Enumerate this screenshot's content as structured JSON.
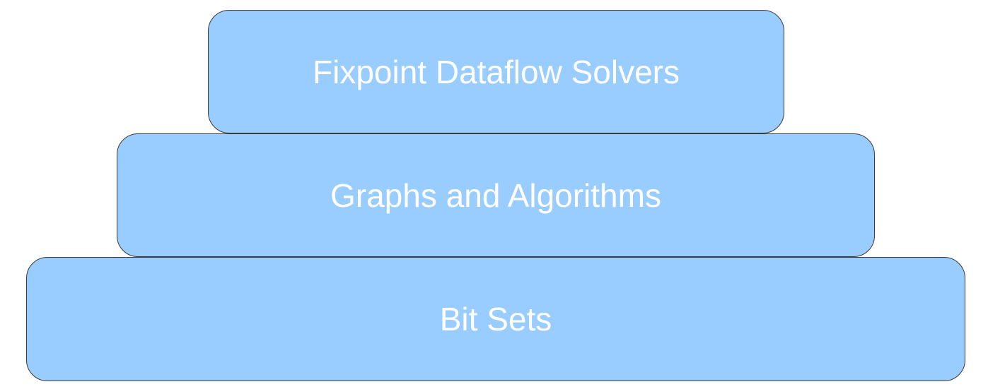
{
  "diagram": {
    "layers": [
      {
        "label": "Fixpoint Dataflow Solvers"
      },
      {
        "label": "Graphs and Algorithms"
      },
      {
        "label": "Bit Sets"
      }
    ],
    "colors": {
      "fill": "#99ccff",
      "border": "#3a3a3a",
      "text": "#ffffff",
      "background": "#ffffff"
    }
  }
}
